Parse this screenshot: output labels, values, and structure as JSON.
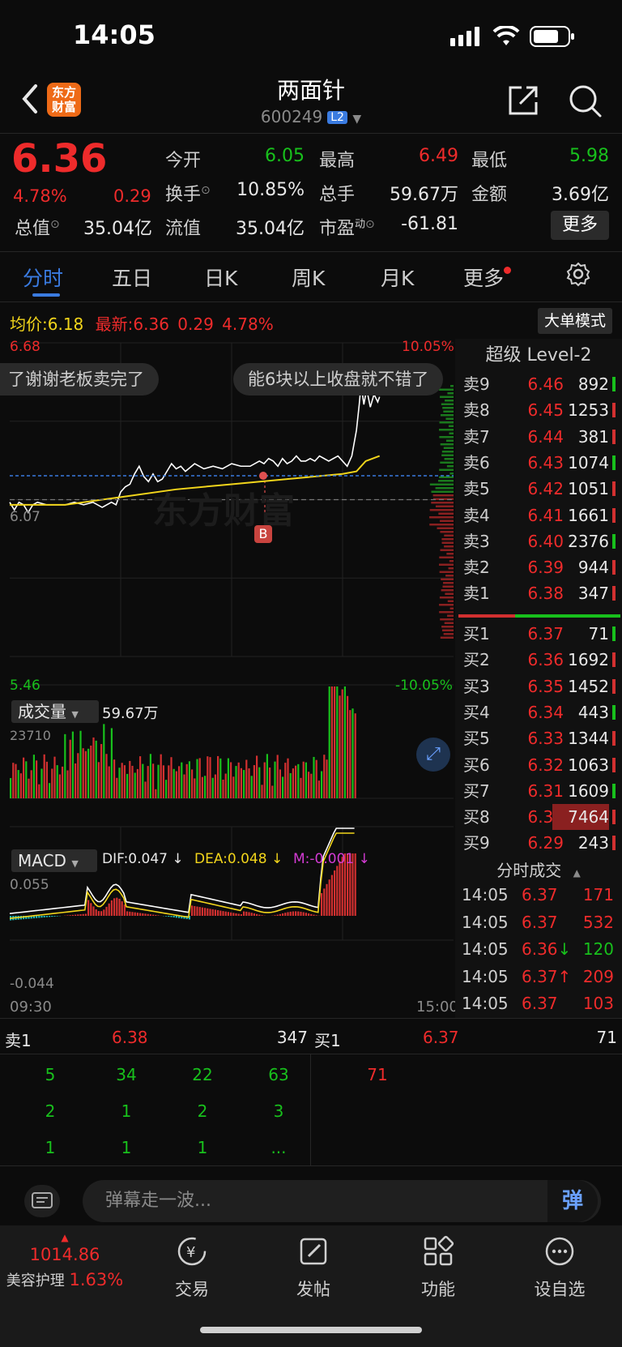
{
  "status_bar": {
    "time": "14:05"
  },
  "header": {
    "logo_text": "东方\n财富",
    "stock_name": "两面针",
    "stock_code": "600249",
    "level_badge": "L2"
  },
  "quote": {
    "price": "6.36",
    "change_pct": "4.78%",
    "change_abs": "0.29",
    "fields": [
      {
        "label": "今开",
        "value": "6.05",
        "color": "green"
      },
      {
        "label": "最高",
        "value": "6.49",
        "color": "red"
      },
      {
        "label": "最低",
        "value": "5.98",
        "color": "green"
      },
      {
        "label": "换手",
        "value": "10.85%",
        "color": "white"
      },
      {
        "label": "总手",
        "value": "59.67万",
        "color": "white"
      },
      {
        "label": "金额",
        "value": "3.69亿",
        "color": "white"
      },
      {
        "label": "总值",
        "value": "35.04亿",
        "color": "white"
      },
      {
        "label": "流值",
        "value": "35.04亿",
        "color": "white"
      },
      {
        "label": "市盈",
        "value": "-61.81",
        "color": "white"
      }
    ],
    "pe_superscript": "动",
    "more_label": "更多"
  },
  "tabs": [
    "分时",
    "五日",
    "日K",
    "周K",
    "月K",
    "更多"
  ],
  "avg_row": {
    "avg_label": "均价:",
    "avg_value": "6.18",
    "latest_label": "最新:",
    "latest_value": "6.36",
    "latest_chg": "0.29",
    "latest_pct": "4.78%",
    "big_order_mode": "大单模式"
  },
  "price_chart": {
    "y_max_label": "6.68",
    "y_min_label": "5.46",
    "y_prev_close_label": "6.07",
    "pct_max_label": "10.05%",
    "pct_min_label": "-10.05%",
    "marker_label": "B",
    "bubble_left": "了谢谢老板卖完了",
    "bubble_right": "能6块以上收盘就不错了"
  },
  "volume_chart": {
    "label": "成交量",
    "total": "59.67万",
    "y_max_label": "23710"
  },
  "macd_chart": {
    "label": "MACD",
    "dif": "DIF:0.047 ↓",
    "dea": "DEA:0.048 ↓",
    "m": "M:-0.001 ↓",
    "y_max_label": "0.055",
    "y_min_label": "-0.044",
    "x_start": "09:30",
    "x_end": "15:00"
  },
  "order_book": {
    "title": "超级 Level-2",
    "asks": [
      {
        "label": "卖9",
        "price": "6.46",
        "vol": "892"
      },
      {
        "label": "卖8",
        "price": "6.45",
        "vol": "1253"
      },
      {
        "label": "卖7",
        "price": "6.44",
        "vol": "381"
      },
      {
        "label": "卖6",
        "price": "6.43",
        "vol": "1074"
      },
      {
        "label": "卖5",
        "price": "6.42",
        "vol": "1051"
      },
      {
        "label": "卖4",
        "price": "6.41",
        "vol": "1661"
      },
      {
        "label": "卖3",
        "price": "6.40",
        "vol": "2376"
      },
      {
        "label": "卖2",
        "price": "6.39",
        "vol": "944"
      },
      {
        "label": "卖1",
        "price": "6.38",
        "vol": "347"
      }
    ],
    "bids": [
      {
        "label": "买1",
        "price": "6.37",
        "vol": "71"
      },
      {
        "label": "买2",
        "price": "6.36",
        "vol": "1692"
      },
      {
        "label": "买3",
        "price": "6.35",
        "vol": "1452"
      },
      {
        "label": "买4",
        "price": "6.34",
        "vol": "443"
      },
      {
        "label": "买5",
        "price": "6.33",
        "vol": "1344"
      },
      {
        "label": "买6",
        "price": "6.32",
        "vol": "1063"
      },
      {
        "label": "买7",
        "price": "6.31",
        "vol": "1609"
      },
      {
        "label": "买8",
        "price": "6.30",
        "vol": "7464"
      },
      {
        "label": "买9",
        "price": "6.29",
        "vol": "243"
      }
    ],
    "trades_title": "分时成交",
    "trades": [
      {
        "time": "14:05",
        "price": "6.37",
        "vol": "171",
        "arrow": "",
        "color": "red"
      },
      {
        "time": "14:05",
        "price": "6.37",
        "vol": "532",
        "arrow": "",
        "color": "red"
      },
      {
        "time": "14:05",
        "price": "6.36",
        "vol": "120",
        "arrow": "↓",
        "color": "green"
      },
      {
        "time": "14:05",
        "price": "6.37",
        "vol": "209",
        "arrow": "↑",
        "color": "red"
      },
      {
        "time": "14:05",
        "price": "6.37",
        "vol": "103",
        "arrow": "",
        "color": "red"
      }
    ]
  },
  "queue": {
    "sell_label": "卖1",
    "sell_price": "6.38",
    "sell_total": "347",
    "buy_label": "买1",
    "buy_price": "6.37",
    "buy_total": "71",
    "sell_rows": [
      [
        "5",
        "34",
        "22",
        "63"
      ],
      [
        "2",
        "1",
        "2",
        "3"
      ],
      [
        "1",
        "1",
        "1",
        "..."
      ]
    ],
    "buy_rows": [
      [
        "71"
      ]
    ]
  },
  "danmu": {
    "placeholder": "弹幕走一波...",
    "send_label": "弹"
  },
  "bottom_nav": {
    "index_value": "1014.86",
    "index_name": "美容护理",
    "index_pct": "1.63%",
    "items": [
      "交易",
      "发帖",
      "功能",
      "设自选"
    ]
  },
  "colors": {
    "up": "#ee2b2b",
    "down": "#18c01c",
    "avg_line": "#f2d51b",
    "accent": "#3a7be0"
  },
  "chart_data": [
    {
      "type": "line",
      "title": "",
      "x_range": [
        "09:30",
        "15:00"
      ],
      "ylim": [
        5.46,
        6.68
      ],
      "prev_close": 6.07,
      "series": [
        {
          "name": "",
          "points": [
            [
              0,
              6.06
            ],
            [
              5,
              6.03
            ],
            [
              10,
              6.06
            ],
            [
              15,
              6.05
            ],
            [
              20,
              6.02
            ],
            [
              25,
              6.05
            ],
            [
              30,
              6.06
            ],
            [
              40,
              6.05
            ],
            [
              50,
              6.05
            ],
            [
              60,
              6.05
            ],
            [
              70,
              6.06
            ],
            [
              80,
              6.05
            ],
            [
              90,
              6.06
            ],
            [
              100,
              6.04
            ],
            [
              110,
              6.06
            ],
            [
              115,
              6.05
            ],
            [
              120,
              6.1
            ],
            [
              125,
              6.12
            ],
            [
              130,
              6.13
            ],
            [
              135,
              6.17
            ],
            [
              140,
              6.2
            ],
            [
              145,
              6.16
            ],
            [
              150,
              6.14
            ],
            [
              155,
              6.17
            ],
            [
              160,
              6.14
            ],
            [
              165,
              6.15
            ],
            [
              170,
              6.18
            ],
            [
              175,
              6.21
            ],
            [
              180,
              6.19
            ],
            [
              185,
              6.2
            ],
            [
              190,
              6.18
            ],
            [
              200,
              6.21
            ],
            [
              210,
              6.19
            ],
            [
              220,
              6.2
            ],
            [
              230,
              6.19
            ],
            [
              240,
              6.21
            ],
            [
              250,
              6.2
            ],
            [
              260,
              6.2
            ],
            [
              270,
              6.22
            ],
            [
              275,
              6.21
            ],
            [
              280,
              6.23
            ],
            [
              285,
              6.22
            ],
            [
              290,
              6.2
            ],
            [
              295,
              6.23
            ],
            [
              300,
              6.21
            ],
            [
              305,
              6.22
            ],
            [
              310,
              6.24
            ],
            [
              315,
              6.22
            ],
            [
              320,
              6.22
            ],
            [
              325,
              6.23
            ],
            [
              330,
              6.22
            ],
            [
              335,
              6.24
            ],
            [
              340,
              6.23
            ],
            [
              345,
              6.22
            ],
            [
              350,
              6.23
            ],
            [
              355,
              6.24
            ],
            [
              360,
              6.22
            ],
            [
              365,
              6.2
            ],
            [
              370,
              6.24
            ],
            [
              375,
              6.34
            ],
            [
              378,
              6.44
            ],
            [
              380,
              6.52
            ],
            [
              383,
              6.44
            ],
            [
              386,
              6.5
            ],
            [
              390,
              6.43
            ],
            [
              394,
              6.48
            ],
            [
              398,
              6.45
            ],
            [
              400,
              6.47
            ]
          ]
        },
        {
          "name": "",
          "points": [
            [
              0,
              6.05
            ],
            [
              60,
              6.05
            ],
            [
              120,
              6.08
            ],
            [
              180,
              6.11
            ],
            [
              240,
              6.13
            ],
            [
              300,
              6.15
            ],
            [
              360,
              6.17
            ],
            [
              375,
              6.18
            ],
            [
              385,
              6.22
            ],
            [
              400,
              6.24
            ]
          ]
        }
      ]
    }
  ]
}
